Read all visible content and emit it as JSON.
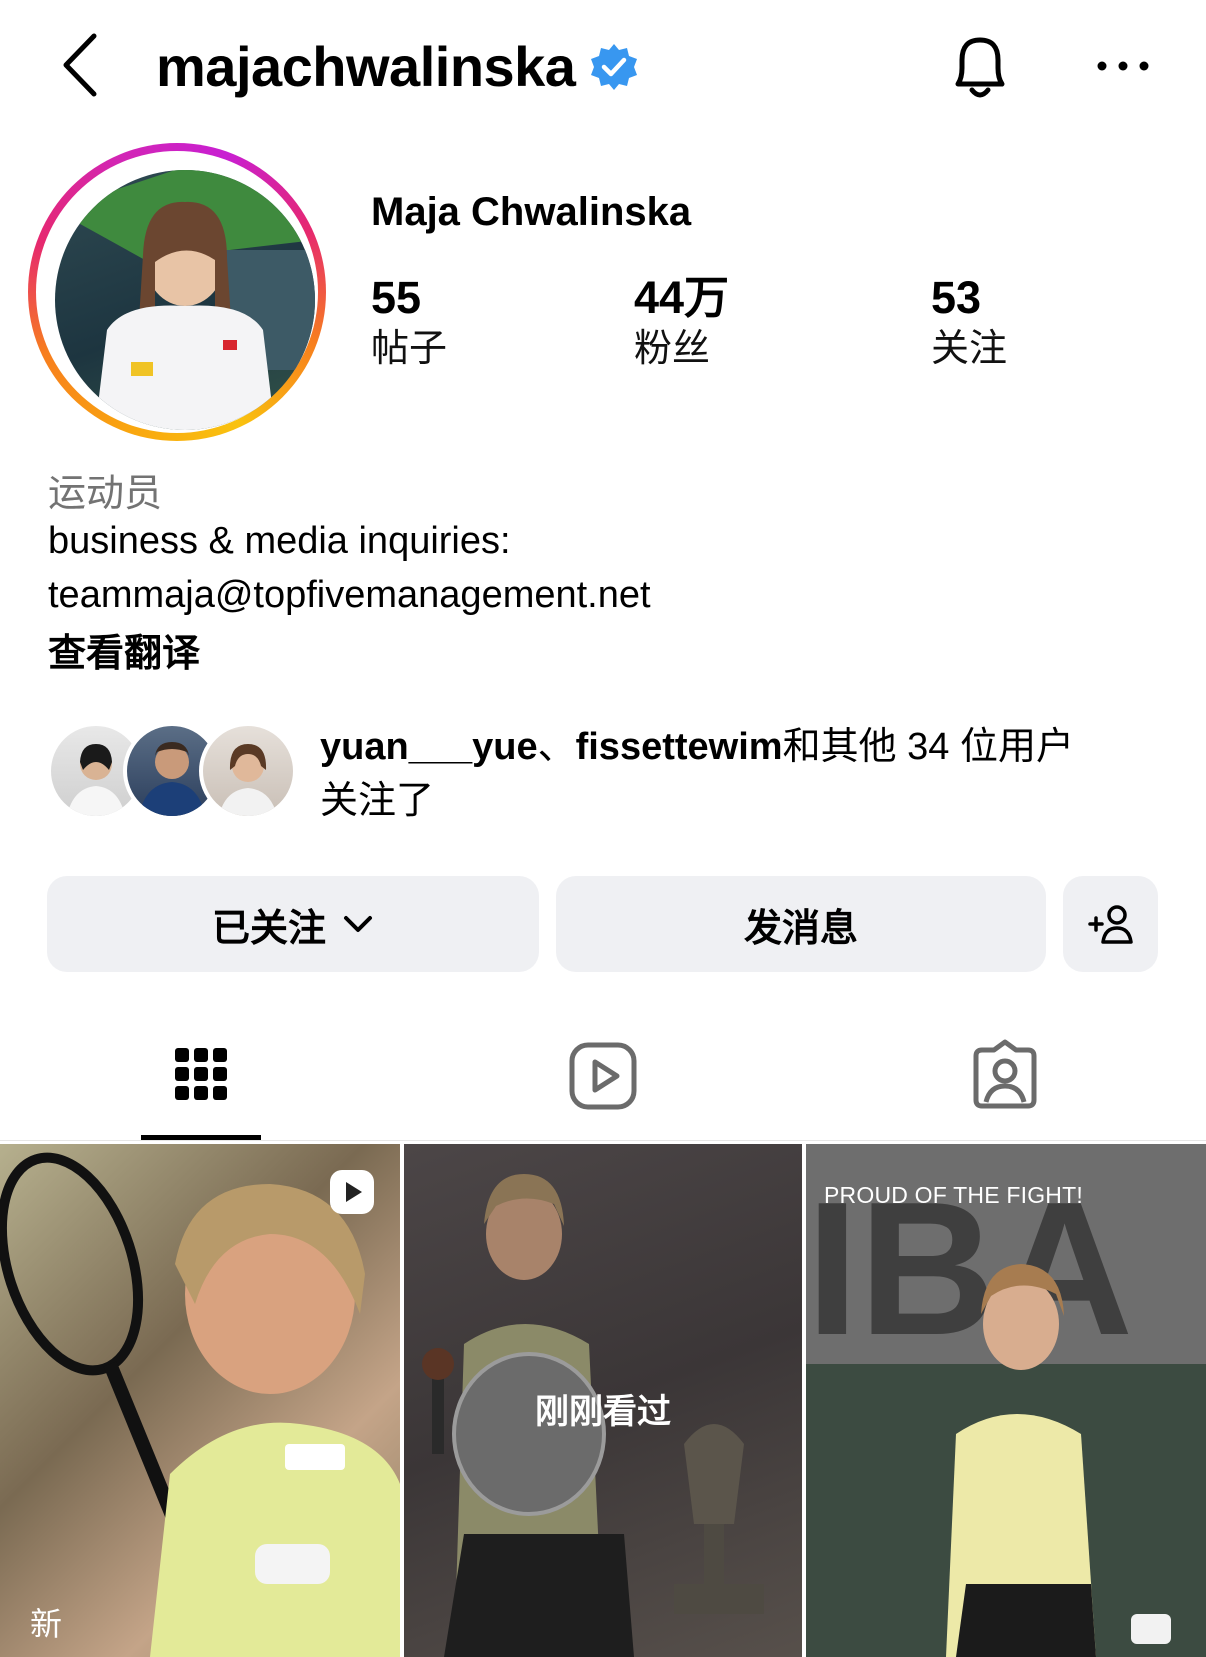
{
  "header": {
    "username": "majachwalinska",
    "verified": true
  },
  "profile": {
    "display_name": "Maja Chwalinska",
    "stats": [
      {
        "value": "55",
        "label": "帖子"
      },
      {
        "value": "44万",
        "label": "粉丝"
      },
      {
        "value": "53",
        "label": "关注"
      }
    ],
    "category": "运动员",
    "bio_line1": "business & media inquiries:",
    "bio_line2": "teammaja@topfivemanagement.net",
    "translate_label": "查看翻译"
  },
  "mutual": {
    "user1": "yuan___yue",
    "separator": "、",
    "user2": "fissettewim",
    "others": "和其他 34 位用户",
    "suffix": "关注了"
  },
  "actions": {
    "following_label": "已关注",
    "message_label": "发消息"
  },
  "tabs": [
    {
      "icon": "grid-icon",
      "active": true
    },
    {
      "icon": "reels-icon",
      "active": false
    },
    {
      "icon": "tagged-icon",
      "active": false
    }
  ],
  "posts": [
    {
      "badge": "reel-icon",
      "label": "新"
    },
    {
      "overlay": "刚刚看过"
    },
    {
      "caption": "PROUD OF THE FIGHT!"
    }
  ],
  "colors": {
    "verified": "#3897f0",
    "button_bg": "#eff0f3",
    "secondary_text": "#737373"
  }
}
